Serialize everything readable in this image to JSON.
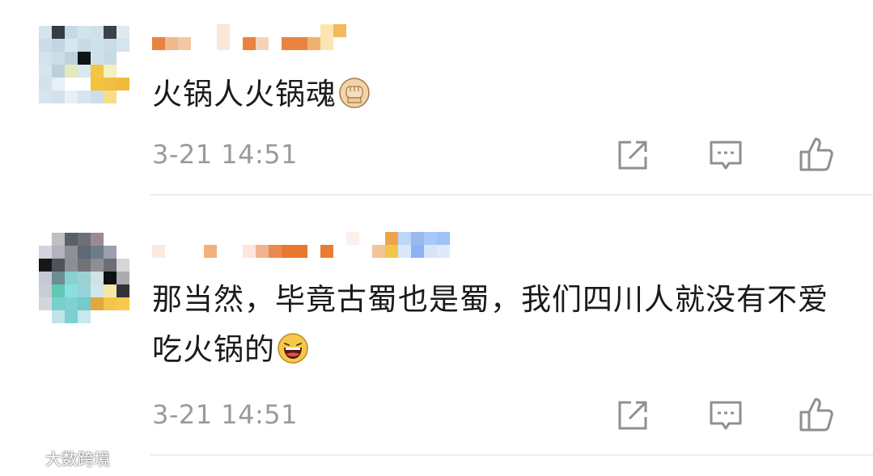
{
  "comments": [
    {
      "text": "火锅人火锅魂",
      "emoji": "fist-emoji",
      "timestamp": "3-21 14:51"
    },
    {
      "text": "那当然，毕竟古蜀也是蜀，我们四川人就没有不爱吃火锅的",
      "emoji": "laughing-emoji",
      "timestamp": "3-21 14:51"
    }
  ],
  "actions": {
    "icons": [
      "share-icon",
      "comment-icon",
      "like-icon"
    ]
  },
  "watermark": {
    "text": "大数跨境"
  },
  "colors": {
    "text": "#1a1a1a",
    "timestamp": "#9a9a9a",
    "divider": "#ececec",
    "icon": "#8f8f8f"
  }
}
